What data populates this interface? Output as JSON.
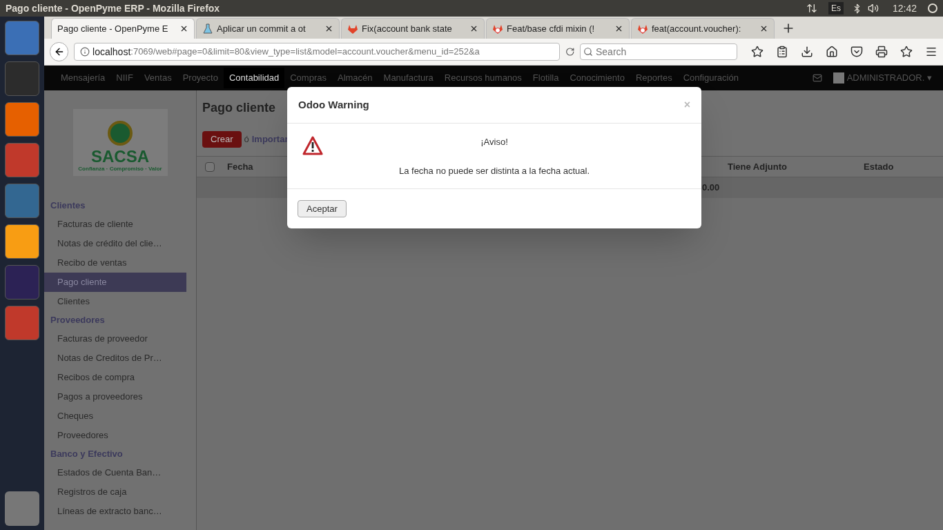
{
  "os_bar": {
    "title": "Pago cliente - OpenPyme ERP - Mozilla Firefox",
    "keyboard": "Es",
    "time": "12:42"
  },
  "browser": {
    "tabs": [
      {
        "label": "Pago cliente - OpenPyme E",
        "selected": true,
        "kind": "page"
      },
      {
        "label": "Aplicar un commit a ot",
        "selected": false,
        "kind": "flask"
      },
      {
        "label": "Fix(account bank state",
        "selected": false,
        "kind": "fox"
      },
      {
        "label": "Feat/base cfdi mixin (!",
        "selected": false,
        "kind": "fox-error"
      },
      {
        "label": "feat(account.voucher):",
        "selected": false,
        "kind": "fox-error"
      }
    ],
    "url_host": "localhost",
    "url_rest": ":7069/web#page=0&limit=80&view_type=list&model=account.voucher&menu_id=252&a",
    "search_placeholder": "Search"
  },
  "top_menu": {
    "items": [
      {
        "label": "Mensajería",
        "selected": false
      },
      {
        "label": "NIIF",
        "selected": false
      },
      {
        "label": "Ventas",
        "selected": false
      },
      {
        "label": "Proyecto",
        "selected": false
      },
      {
        "label": "Contabilidad",
        "selected": true
      },
      {
        "label": "Compras",
        "selected": false
      },
      {
        "label": "Almacén",
        "selected": false
      },
      {
        "label": "Manufactura",
        "selected": false
      },
      {
        "label": "Recursos humanos",
        "selected": false
      },
      {
        "label": "Flotilla",
        "selected": false
      },
      {
        "label": "Conocimiento",
        "selected": false
      },
      {
        "label": "Reportes",
        "selected": false
      },
      {
        "label": "Configuración",
        "selected": false
      }
    ],
    "user": "ADMINISTRADOR.",
    "user_caret": "▾"
  },
  "logo": {
    "name": "SACSA",
    "tagline": "Confianza · Compromiso · Valor"
  },
  "sidebar": {
    "sections": [
      {
        "title": "Clientes",
        "items": [
          {
            "label": "Facturas de cliente",
            "selected": false
          },
          {
            "label": "Notas de crédito del clie…",
            "selected": false
          },
          {
            "label": "Recibo de ventas",
            "selected": false
          },
          {
            "label": "Pago cliente",
            "selected": true
          },
          {
            "label": "Clientes",
            "selected": false
          }
        ]
      },
      {
        "title": "Proveedores",
        "items": [
          {
            "label": "Facturas de proveedor",
            "selected": false
          },
          {
            "label": "Notas de Creditos de Pr…",
            "selected": false
          },
          {
            "label": "Recibos de compra",
            "selected": false
          },
          {
            "label": "Pagos a proveedores",
            "selected": false
          },
          {
            "label": "Cheques",
            "selected": false
          },
          {
            "label": "Proveedores",
            "selected": false
          }
        ]
      },
      {
        "title": "Banco y Efectivo",
        "items": [
          {
            "label": "Estados de Cuenta Ban…",
            "selected": false
          },
          {
            "label": "Registros de caja",
            "selected": false
          },
          {
            "label": "Líneas de extracto banc…",
            "selected": false
          }
        ]
      }
    ]
  },
  "content": {
    "title": "Pago cliente",
    "create": "Crear",
    "or": "ó",
    "import": "Importar",
    "select_all": {
      "checked": false
    },
    "columns": [
      "Fecha",
      "Tiene Adjunto",
      "Estado"
    ],
    "total": "0.00"
  },
  "dialog": {
    "title": "Odoo Warning",
    "close": "×",
    "heading": "¡Aviso!",
    "message": "La fecha no puede ser distinta a la fecha actual.",
    "button": "Aceptar"
  }
}
